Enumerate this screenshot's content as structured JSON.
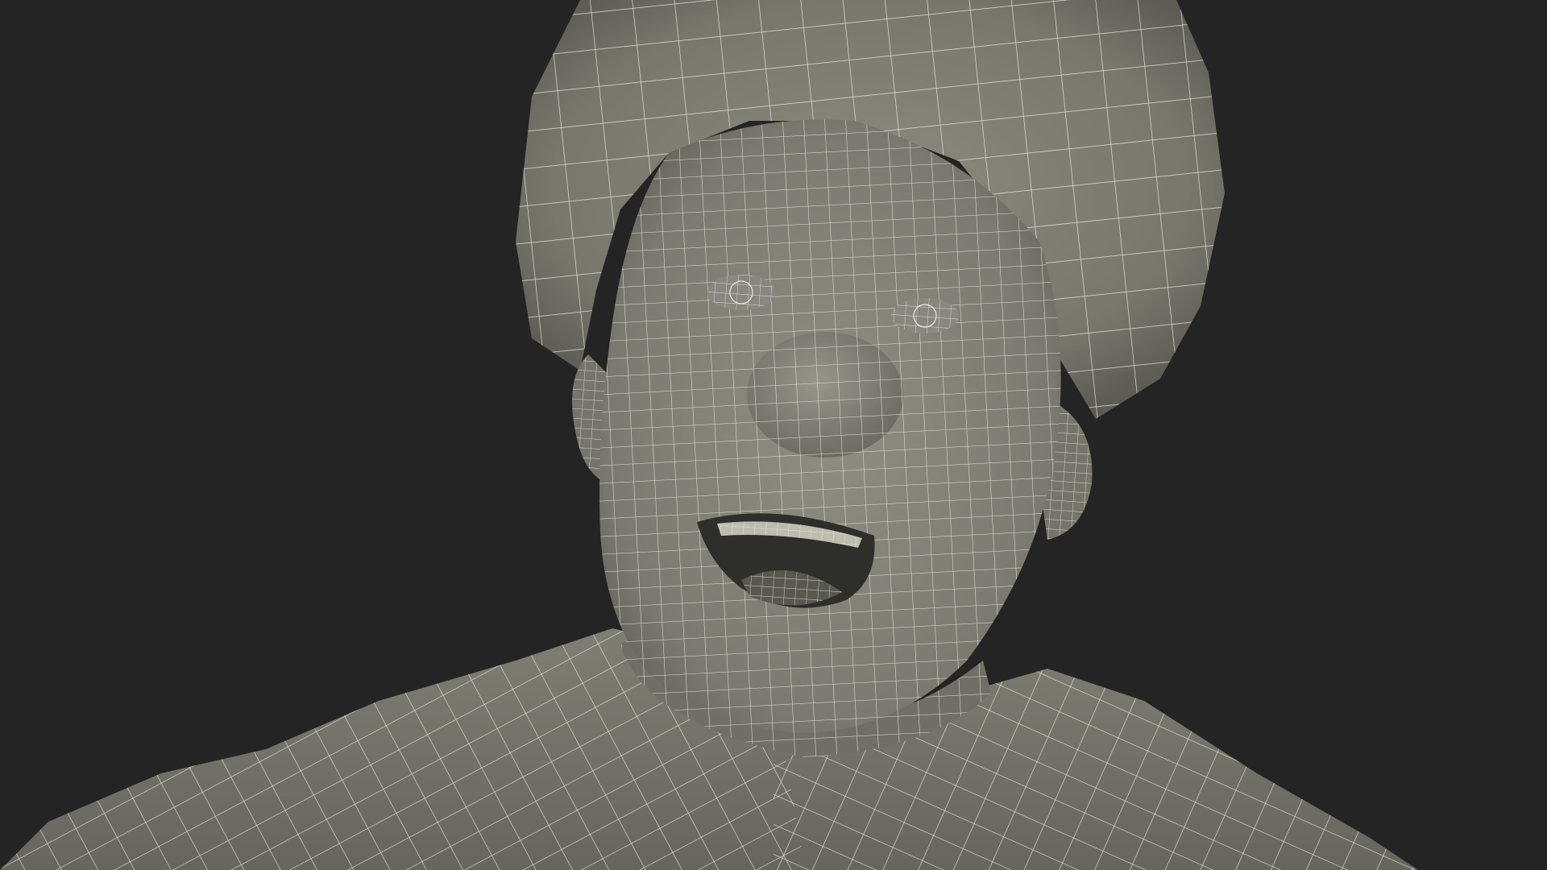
{
  "scene": {
    "background_color": "#242424",
    "surface_color": "#7d7d72",
    "surface_shadow_color": "#5f5f57",
    "surface_highlight_color": "#8e8e83",
    "wire_color": "#ecebdc",
    "interior_color": "#2e2e2b",
    "subject": "wireframe-clown-bust"
  }
}
